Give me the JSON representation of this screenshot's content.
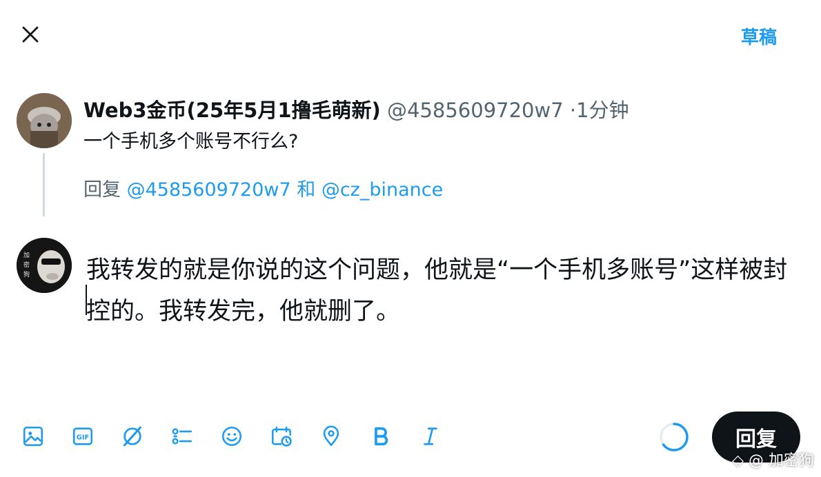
{
  "header": {
    "close_icon": "close-icon",
    "drafts_label": "草稿"
  },
  "original_post": {
    "author_name": "Web3金币(25年5月1撸毛萌新)",
    "handle": "@4585609720w7",
    "separator": "·",
    "time": "1分钟",
    "text": "一个手机多个账号不行么?"
  },
  "reply_context": {
    "prefix": "回复",
    "mention_1": "@4585609720w7",
    "conjunction": "和",
    "mention_2": "@cz_binance"
  },
  "composer": {
    "text": "我转发的就是你说的这个问题，他就是“一个手机多账号”这样被封控的。我转发完，他就删了。"
  },
  "toolbar": {
    "icons": [
      "image-icon",
      "gif-icon",
      "grok-icon",
      "poll-icon",
      "emoji-icon",
      "schedule-icon",
      "location-icon",
      "bold-icon",
      "italic-icon"
    ],
    "reply_label": "回复"
  },
  "character_progress": 0.65,
  "watermark": "◇ @ 加密狗",
  "colors": {
    "accent": "#1d9bf0",
    "text": "#0f1419",
    "secondary": "#536471",
    "button_bg": "#0f1419"
  }
}
